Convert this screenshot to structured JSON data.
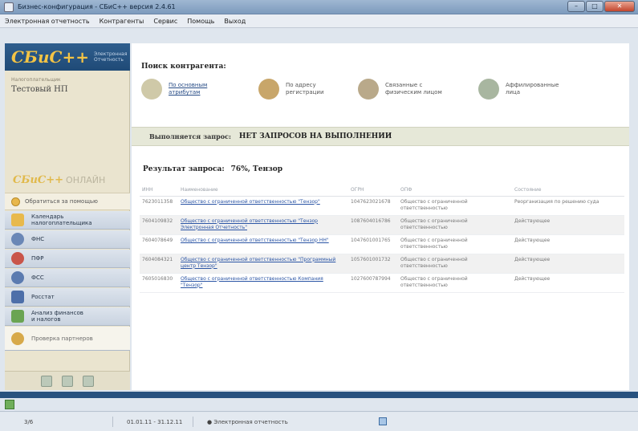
{
  "window": {
    "title": "Бизнес-конфигурация - СБиС++ версия 2.4.61"
  },
  "menubar": [
    "Электронная отчетность",
    "Контрагенты",
    "Сервис",
    "Помощь",
    "Выход"
  ],
  "sidebar": {
    "logo": "СБиС++",
    "logo_sub": "Электронная\nОтчетность",
    "org_label": "Налогоплательщик",
    "org_name": "Тестовый НП",
    "online_logo": "СБиС++",
    "online_suffix": "ОНЛАЙН",
    "help": "Обратиться за помощью",
    "items": [
      {
        "label": "Календарь\nналогоплательщика",
        "icon": "calendar-icon",
        "color": "#e8b94c"
      },
      {
        "label": "ФНС",
        "icon": "fns-icon",
        "color": "#6a87b6"
      },
      {
        "label": "ПФР",
        "icon": "pfr-icon",
        "color": "#c9554a"
      },
      {
        "label": "ФСС",
        "icon": "fss-icon",
        "color": "#5b7bb0"
      },
      {
        "label": "Росстат",
        "icon": "rosstat-icon",
        "color": "#4d6fa9"
      },
      {
        "label": "Анализ финансов\nи налогов",
        "icon": "analysis-icon",
        "color": "#6aa453"
      },
      {
        "label": "Проверка партнеров",
        "icon": "partners-check-icon",
        "color": "#d7a94a"
      }
    ]
  },
  "main": {
    "search_heading": "Поиск контрагента:",
    "search_options": [
      {
        "label": "По основным\nатрибутам",
        "link": true,
        "icon": "attributes-icon",
        "color": "#cfc9a8"
      },
      {
        "label": "По адресу\nрегистрации",
        "link": false,
        "icon": "address-icon",
        "color": "#c8a66a"
      },
      {
        "label": "Связанные с\nфизическим лицом",
        "link": false,
        "icon": "person-icon",
        "color": "#b9a98a"
      },
      {
        "label": "Аффилированные\nлица",
        "link": false,
        "icon": "affiliated-icon",
        "color": "#a8b6a0"
      }
    ],
    "exec_label": "Выполняется запрос:",
    "exec_value": "НЕТ ЗАПРОСОВ НА ВЫПОЛНЕНИИ",
    "result_label": "Результат запроса:",
    "result_value": "76%, Тензор",
    "table": {
      "headers": [
        "ИНН",
        "Наименование",
        "ОГРН",
        "ОПФ",
        "Состояние"
      ],
      "rows": [
        [
          "7623011358",
          "Общество с ограниченной ответственностью \"Тензор\"",
          "1047623021678",
          "Общество с ограниченной ответственностью",
          "Реорганизация по решению суда"
        ],
        [
          "7604109832",
          "Общество с ограниченной ответственностью \"Тензор Электронная Отчетность\"",
          "1087604016786",
          "Общество с ограниченной ответственностью",
          "Действующее"
        ],
        [
          "7604078649",
          "Общество с ограниченной ответственностью \"Тензор НН\"",
          "1047601001765",
          "Общество с ограниченной ответственностью",
          "Действующее"
        ],
        [
          "7604084321",
          "Общество с ограниченной ответственностью \"Программный центр Тензор\"",
          "1057601001732",
          "Общество с ограниченной ответственностью",
          "Действующее"
        ],
        [
          "7605016830",
          "Общество с ограниченной ответственностью Компания \"Тензор\"",
          "1027600787994",
          "Общество с ограниченной ответственностью",
          "Действующее"
        ]
      ]
    }
  },
  "statusbar": {
    "page": "3/6",
    "period": "01.01.11 - 31.12.11",
    "mode": "Электронная отчетность"
  }
}
